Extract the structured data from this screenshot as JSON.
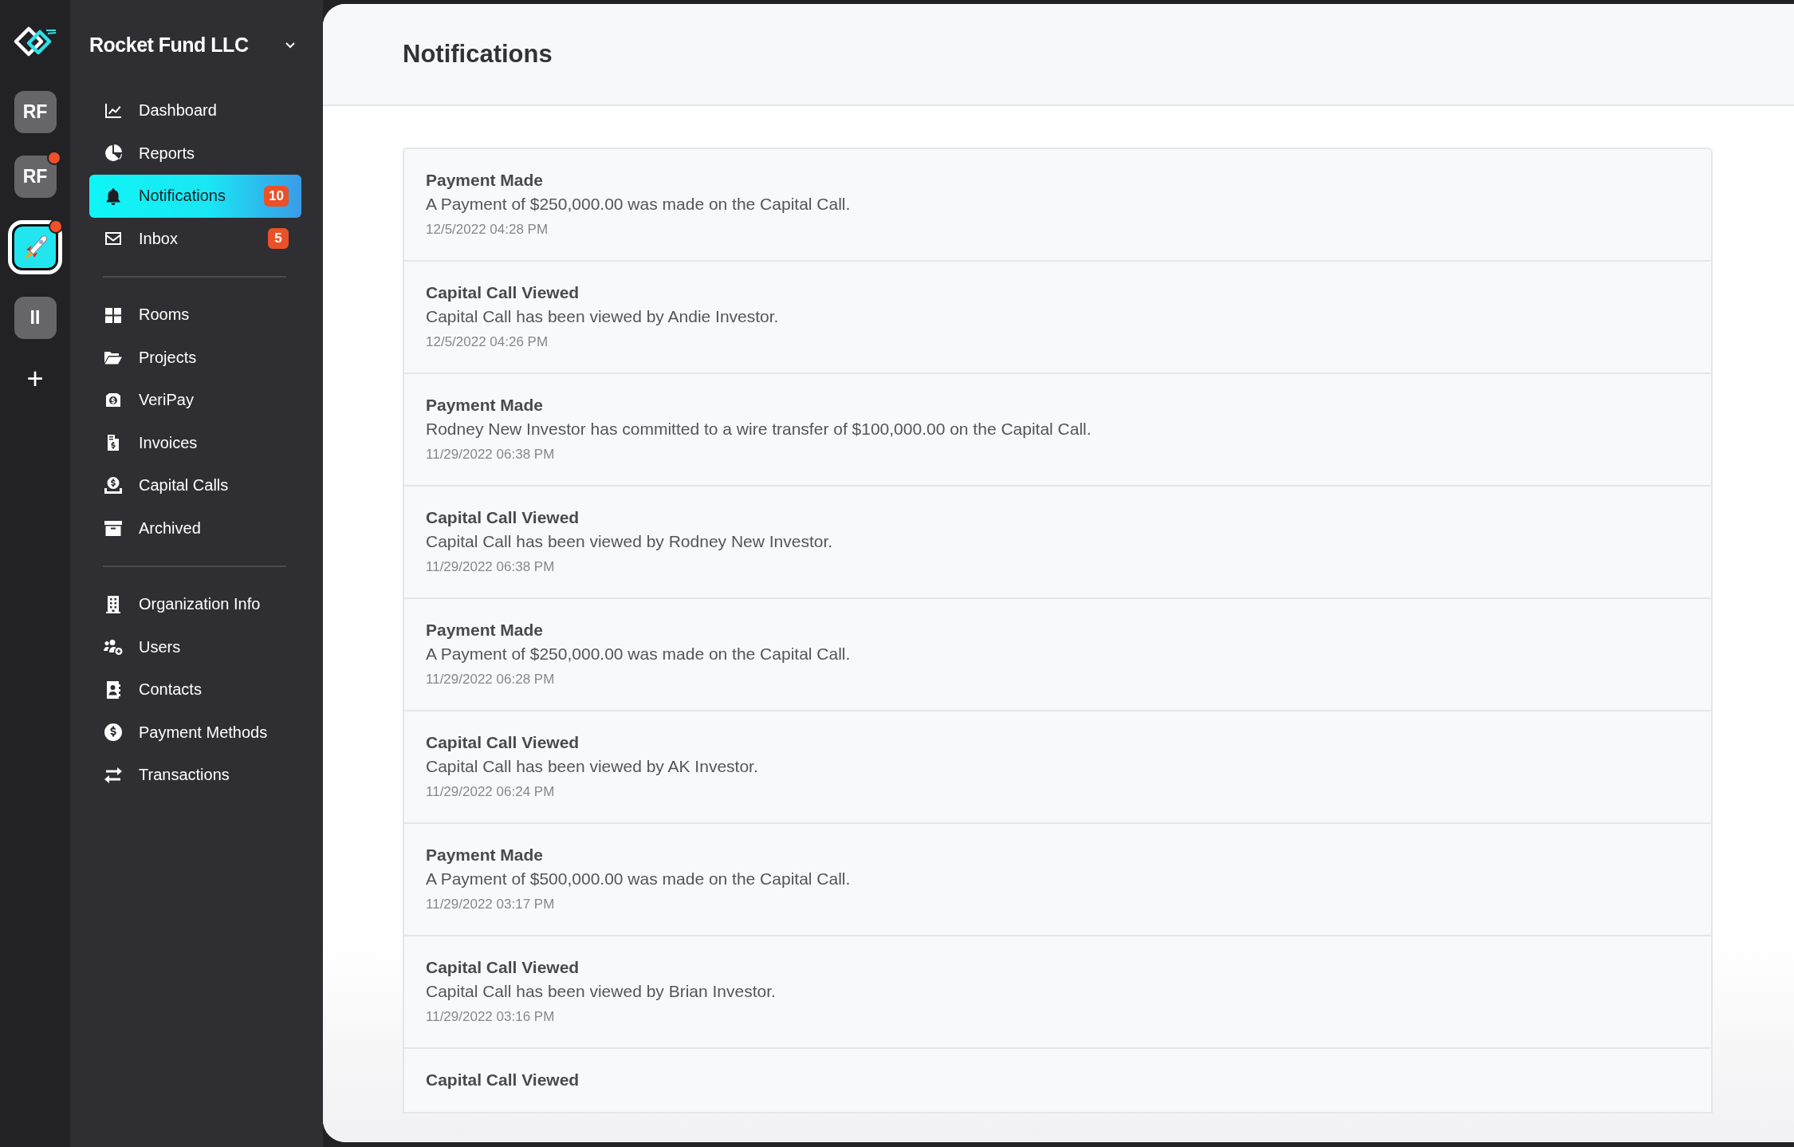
{
  "rail": {
    "workspaces": [
      {
        "kind": "initials",
        "label": "RF",
        "selected": false,
        "unread": false
      },
      {
        "kind": "initials",
        "label": "RF",
        "selected": false,
        "unread": true
      },
      {
        "kind": "image",
        "selected": true,
        "unread": true
      },
      {
        "kind": "initials",
        "label": "II",
        "selected": false,
        "unread": false
      }
    ],
    "add_button": "+"
  },
  "sidebar": {
    "organization": "Rocket Fund LLC",
    "groups": [
      {
        "items": [
          {
            "label": "Dashboard",
            "selected": false
          },
          {
            "label": "Reports",
            "selected": false
          },
          {
            "label": "Notifications",
            "selected": true,
            "badge": "10"
          },
          {
            "label": "Inbox",
            "selected": false,
            "badge": "5"
          }
        ]
      },
      {
        "items": [
          {
            "label": "Rooms",
            "selected": false
          },
          {
            "label": "Projects",
            "selected": false
          },
          {
            "label": "VeriPay",
            "selected": false
          },
          {
            "label": "Invoices",
            "selected": false
          },
          {
            "label": "Capital Calls",
            "selected": false
          },
          {
            "label": "Archived",
            "selected": false
          }
        ]
      },
      {
        "items": [
          {
            "label": "Organization Info",
            "selected": false
          },
          {
            "label": "Users",
            "selected": false
          },
          {
            "label": "Contacts",
            "selected": false
          },
          {
            "label": "Payment Methods",
            "selected": false
          },
          {
            "label": "Transactions",
            "selected": false
          }
        ]
      }
    ]
  },
  "page": {
    "title": "Notifications"
  },
  "notifications": [
    {
      "title": "Payment Made",
      "message": "A Payment of $250,000.00 was made on the Capital Call.",
      "time": "12/5/2022 04:28 PM"
    },
    {
      "title": "Capital Call Viewed",
      "message": "Capital Call has been viewed by Andie Investor.",
      "time": "12/5/2022 04:26 PM"
    },
    {
      "title": "Payment Made",
      "message": "Rodney New Investor has committed to a wire transfer of $100,000.00 on the Capital Call.",
      "time": "11/29/2022 06:38 PM"
    },
    {
      "title": "Capital Call Viewed",
      "message": "Capital Call has been viewed by Rodney New Investor.",
      "time": "11/29/2022 06:38 PM"
    },
    {
      "title": "Payment Made",
      "message": "A Payment of $250,000.00 was made on the Capital Call.",
      "time": "11/29/2022 06:28 PM"
    },
    {
      "title": "Capital Call Viewed",
      "message": "Capital Call has been viewed by AK Investor.",
      "time": "11/29/2022 06:24 PM"
    },
    {
      "title": "Payment Made",
      "message": "A Payment of $500,000.00 was made on the Capital Call.",
      "time": "11/29/2022 03:17 PM"
    },
    {
      "title": "Capital Call Viewed",
      "message": "Capital Call has been viewed by Brian Investor.",
      "time": "11/29/2022 03:16 PM"
    },
    {
      "title": "Capital Call Viewed"
    }
  ]
}
